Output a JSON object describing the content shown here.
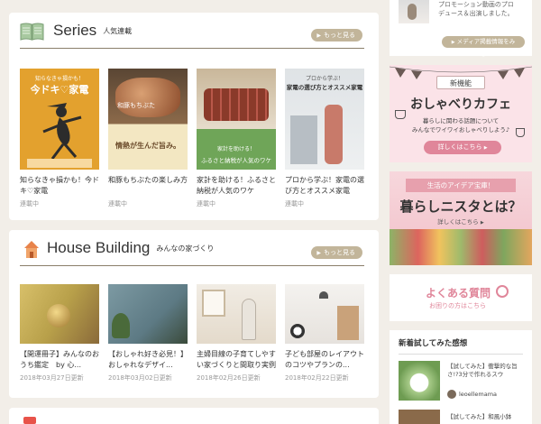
{
  "series": {
    "title": "Series",
    "subtitle": "人気連載",
    "more": "もっと見る",
    "cards": [
      {
        "title": "知らなきゃ損かも！今ドキ♡家電",
        "meta": "連載中",
        "thumb_lines": [
          "知らなきゃ損かも！",
          "今ドキ♡家電"
        ]
      },
      {
        "title": "和豚もちぶたの楽しみ方",
        "meta": "連載中",
        "thumb_lines": [
          "和豚もちぶた",
          "情熱が生んだ旨み。"
        ]
      },
      {
        "title": "家計を助ける！ふるさと納税が人気のワケ",
        "meta": "連載中",
        "thumb_lines": [
          "家計を助ける！",
          "ふるさと納税が人気のワケ"
        ]
      },
      {
        "title": "プロから学ぶ！家電の選び方とオススメ家電",
        "meta": "連載中",
        "thumb_lines": [
          "プロから学ぶ！",
          "家電の選び方とオススメ家電"
        ]
      }
    ]
  },
  "house": {
    "title": "House Building",
    "subtitle": "みんなの家づくり",
    "more": "もっと見る",
    "cards": [
      {
        "title": "【開運冊子】みんなのおうち鑑定　by 心...",
        "meta": "2018年03月27日更新"
      },
      {
        "title": "【おしゃれ好き必見！】おしゃれなデザイ...",
        "meta": "2018年03月02日更新"
      },
      {
        "title": "主婦目線の子育てしやすい家づくりと間取り実例",
        "meta": "2018年02月26日更新"
      },
      {
        "title": "子ども部屋のレイアウトのコツやプランの...",
        "meta": "2018年02月22日更新"
      }
    ]
  },
  "sidebar": {
    "top_box": {
      "text_lines": [
        "プロモーション動画のプロ",
        "デュース＆出演しました。"
      ],
      "button": "メディア掲載情報をみる"
    },
    "cafe": {
      "badge": "新機能",
      "title": "おしゃべりカフェ",
      "desc_lines": [
        "暮らしに関わる話題について",
        "みんなでワイワイおしゃべりしよう♪"
      ],
      "button": "詳しくはこちら"
    },
    "kurashi": {
      "top": "生活のアイデア宝庫！",
      "title": "暮らしニスタとは？",
      "button": "詳しくはこちら"
    },
    "faq": {
      "title": "よくある質問",
      "sub": "お困りの方はこちら"
    },
    "reviews": {
      "heading": "新着試してみた感想",
      "items": [
        {
          "text": "【試してみた】衝撃的な旨さ!?3分で作れるスウ",
          "user": "leoellemama"
        },
        {
          "text": "【試してみた】和風小鉢"
        }
      ]
    }
  },
  "colors": {
    "accent": "#c2b59a",
    "pink": "#e0869a",
    "background": "#f2eee8"
  }
}
